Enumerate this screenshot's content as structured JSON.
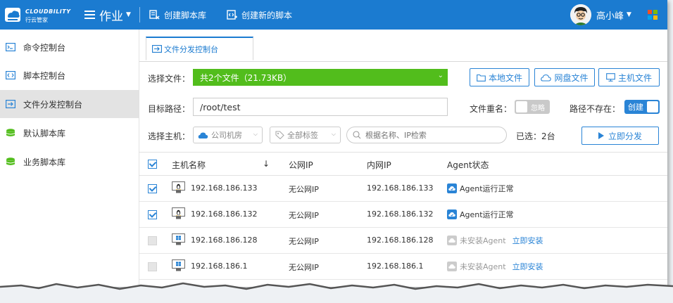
{
  "topbar": {
    "brand_name": "CLOUDBILITY",
    "brand_cn": "行云管家",
    "module_title": "作业",
    "links": [
      {
        "label": "创建脚本库",
        "icon": "script-library-icon"
      },
      {
        "label": "创建新的脚本",
        "icon": "new-script-icon"
      }
    ],
    "user_name": "高小峰"
  },
  "sidebar": {
    "items": [
      {
        "label": "命令控制台",
        "icon": "terminal-icon",
        "active": false
      },
      {
        "label": "脚本控制台",
        "icon": "code-icon",
        "active": false
      },
      {
        "label": "文件分发控制台",
        "icon": "file-dispatch-icon",
        "active": true
      },
      {
        "label": "默认脚本库",
        "icon": "database-icon",
        "active": false
      },
      {
        "label": "业务脚本库",
        "icon": "database-icon",
        "active": false
      }
    ]
  },
  "tab": {
    "label": "文件分发控制台"
  },
  "form": {
    "select_file_label": "选择文件：",
    "file_summary": "共2个文件（21.73KB）",
    "local_file_btn": "本地文件",
    "cloud_file_btn": "网盘文件",
    "host_file_btn": "主机文件",
    "target_path_label": "目标路径：",
    "target_path_value": "/root/test",
    "rename_label": "文件重名：",
    "rename_toggle": "忽略",
    "path_missing_label": "路径不存在：",
    "path_missing_toggle": "创建",
    "select_host_label": "选择主机：",
    "region_select": "公司机房",
    "tag_select": "全部标签",
    "search_placeholder": "根据名称、IP检索",
    "selected_count": "已选：2台",
    "dispatch_btn": "立即分发"
  },
  "table": {
    "headers": {
      "name": "主机名称",
      "sort": "↓",
      "public_ip": "公网IP",
      "private_ip": "内网IP",
      "agent": "Agent状态"
    },
    "rows": [
      {
        "checked": true,
        "os": "linux",
        "name": "192.168.186.133",
        "public_ip": "无公网IP",
        "private_ip": "192.168.186.133",
        "agent_status": "Agent运行正常",
        "installed": true,
        "install_link": ""
      },
      {
        "checked": true,
        "os": "linux",
        "name": "192.168.186.132",
        "public_ip": "无公网IP",
        "private_ip": "192.168.186.132",
        "agent_status": "Agent运行正常",
        "installed": true,
        "install_link": ""
      },
      {
        "checked": false,
        "os": "windows",
        "name": "192.168.186.128",
        "public_ip": "无公网IP",
        "private_ip": "192.168.186.128",
        "agent_status": "未安装Agent",
        "installed": false,
        "install_link": "立即安装"
      },
      {
        "checked": false,
        "os": "windows",
        "name": "192.168.186.1",
        "public_ip": "无公网IP",
        "private_ip": "192.168.186.1",
        "agent_status": "未安装Agent",
        "installed": false,
        "install_link": "立即安装"
      }
    ]
  },
  "colors": {
    "topbar": "#1b7bd0",
    "accent": "#2a84d6",
    "file_bar": "#52bd1c",
    "sidebar_db_icon": "#52bd1c",
    "agent_ok": "#2a84d6",
    "agent_missing": "#cccccc"
  }
}
